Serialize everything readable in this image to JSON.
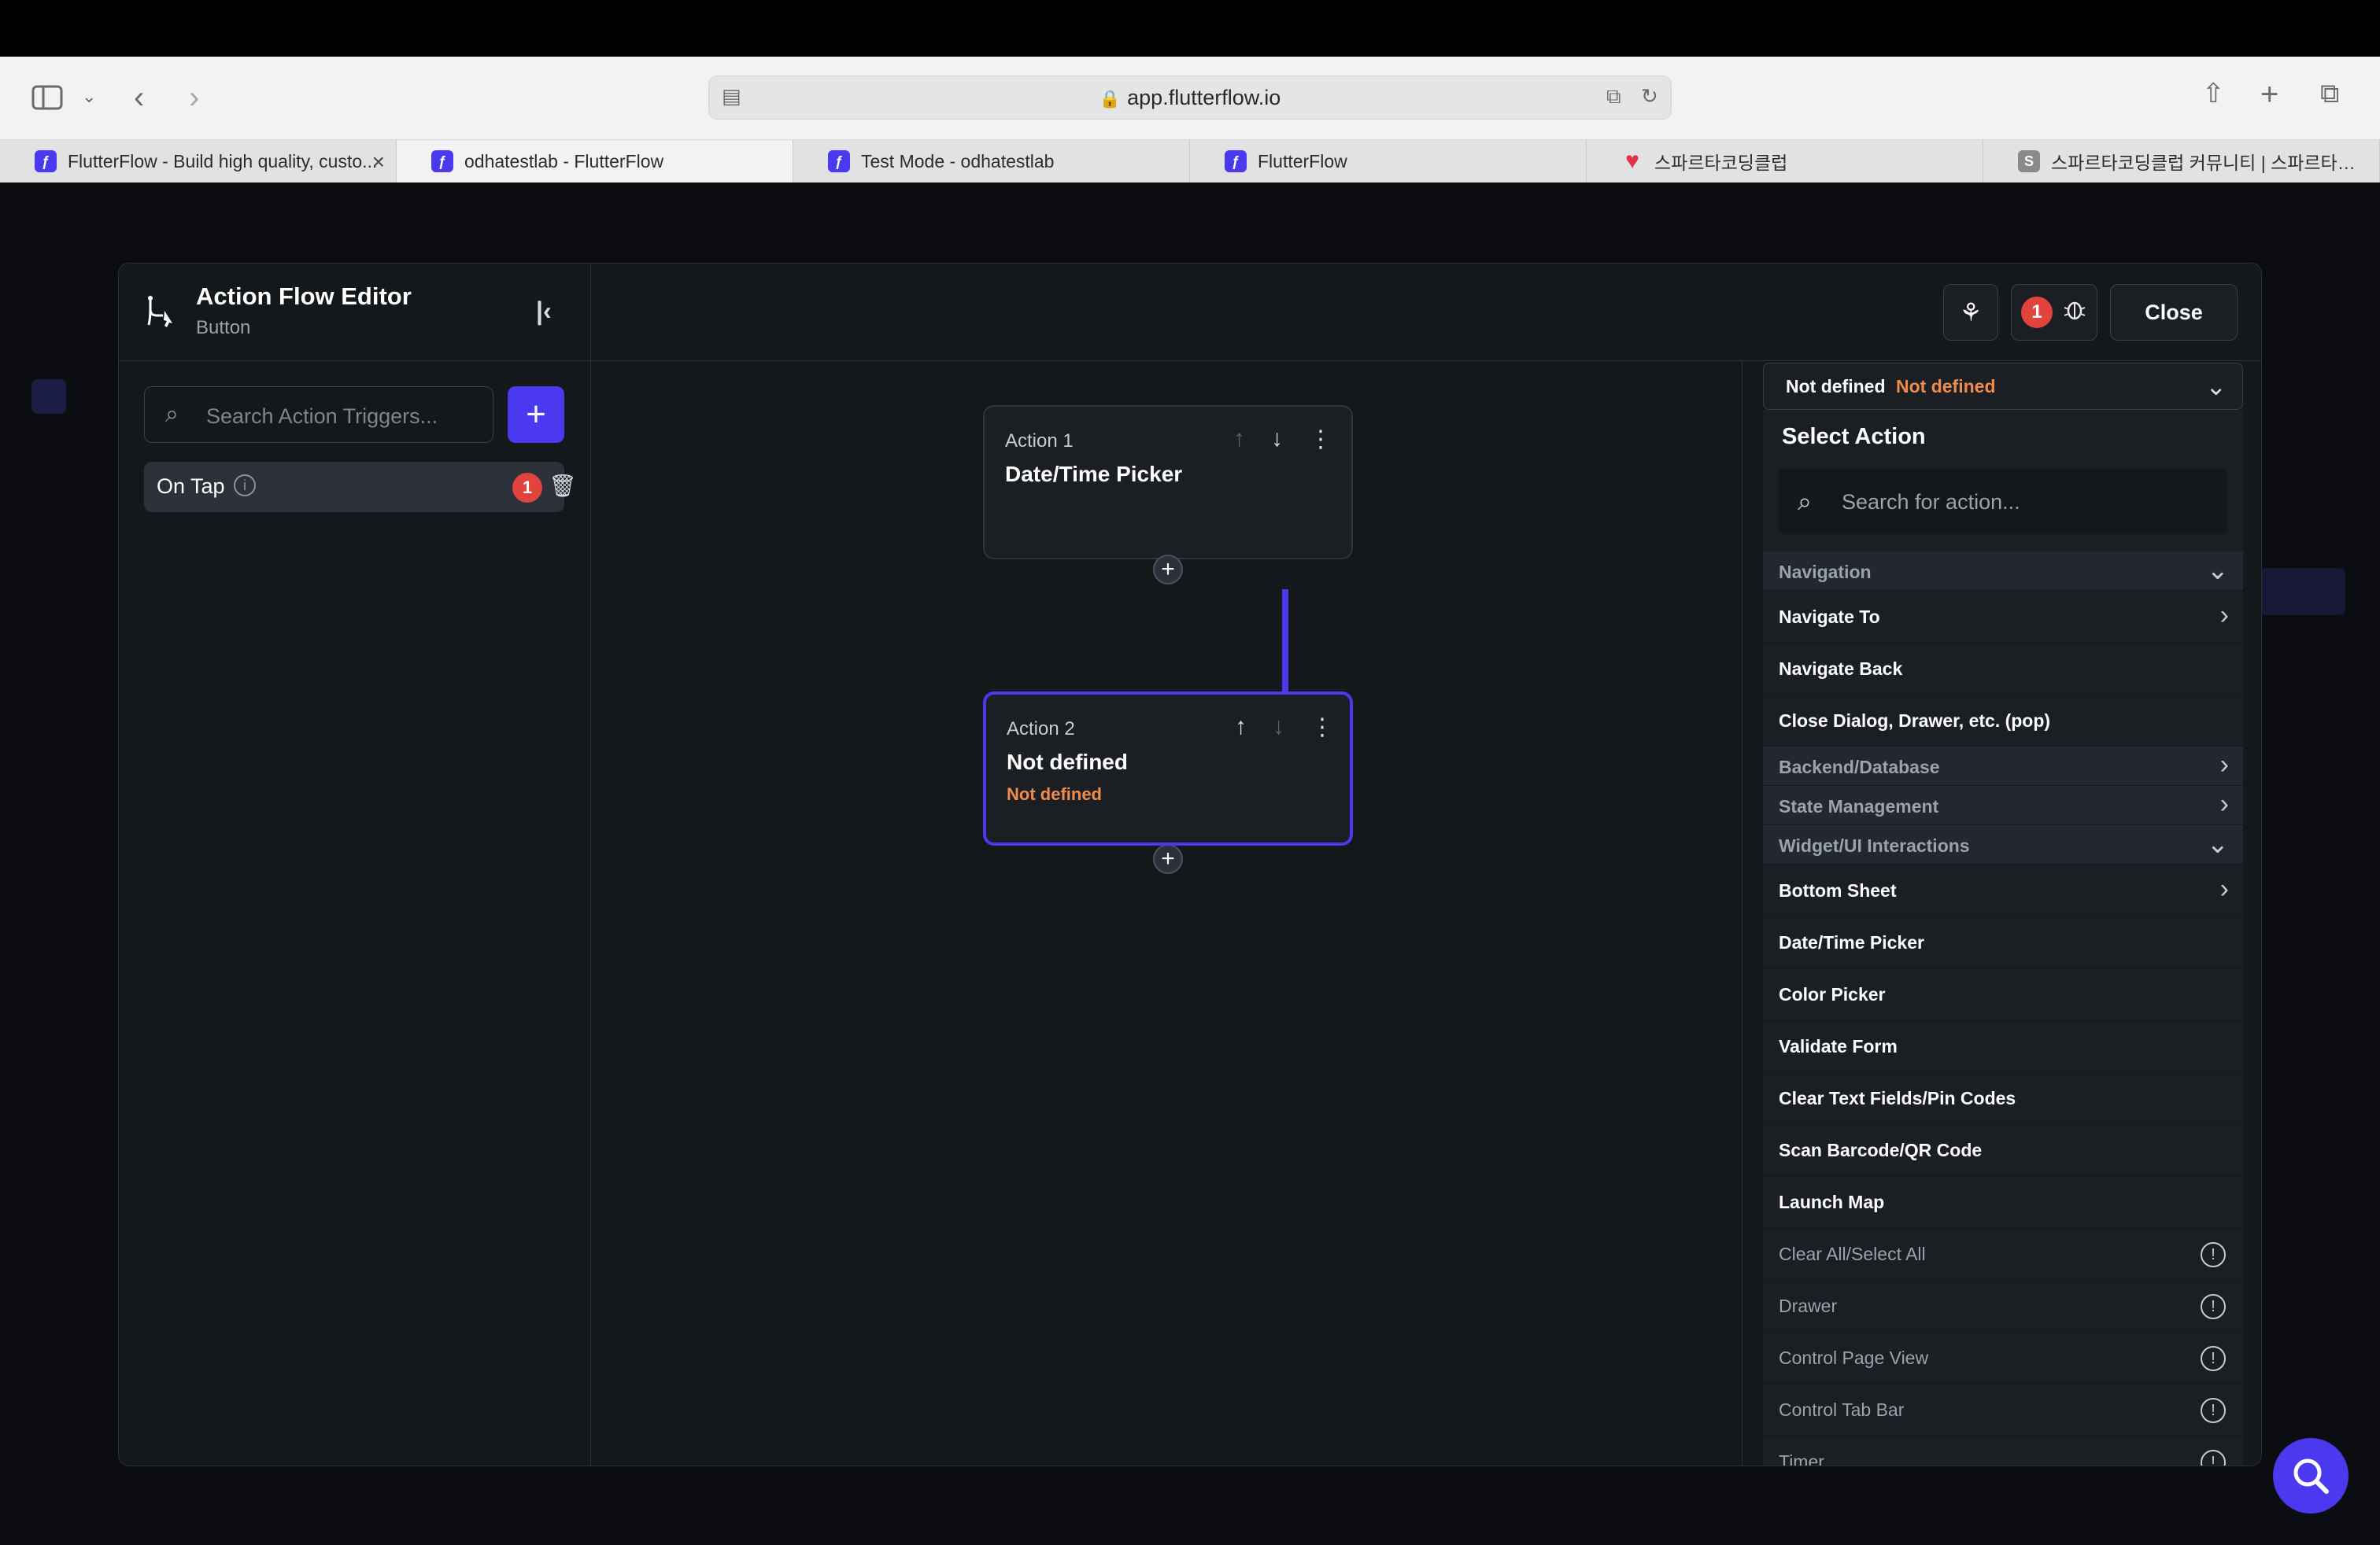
{
  "browser": {
    "url": "app.flutterflow.io",
    "tabs": [
      {
        "label": "FlutterFlow - Build high quality, custo...",
        "icon": "flutterflow-logo-icon"
      },
      {
        "label": "odhatestlab - FlutterFlow",
        "icon": "flutterflow-app-icon"
      },
      {
        "label": "Test Mode - odhatestlab",
        "icon": "flutterflow-app-icon"
      },
      {
        "label": "FlutterFlow",
        "icon": "flutterflow-app-icon"
      },
      {
        "label": "스파르타코딩클럽",
        "icon": "sparta-heart-icon"
      },
      {
        "label": "스파르타코딩클럽 커뮤니티 | 스파르타코딩클...",
        "icon": "sparta-s-icon",
        "icon_text": "S"
      }
    ]
  },
  "editor": {
    "title": "Action Flow Editor",
    "subtitle": "Button",
    "debug_count": "1",
    "close_label": "Close"
  },
  "triggers": {
    "search_placeholder": "Search Action Triggers...",
    "items": [
      {
        "label": "On Tap",
        "badge": "1"
      }
    ]
  },
  "flow": {
    "actions": [
      {
        "label": "Action 1",
        "title": "Date/Time Picker",
        "subtitle": ""
      },
      {
        "label": "Action 2",
        "title": "Not defined",
        "subtitle": "Not defined"
      }
    ]
  },
  "select_action": {
    "current_value": "Not defined",
    "current_status": "Not defined",
    "title": "Select Action",
    "search_placeholder": "Search for action...",
    "rows": [
      {
        "label": "Navigation",
        "kind": "category",
        "chevron": "down"
      },
      {
        "label": "Navigate To",
        "kind": "item",
        "chevron": "right"
      },
      {
        "label": "Navigate Back",
        "kind": "item"
      },
      {
        "label": "Close Dialog, Drawer, etc. (pop)",
        "kind": "item"
      },
      {
        "label": "Backend/Database",
        "kind": "category",
        "chevron": "right"
      },
      {
        "label": "State Management",
        "kind": "category",
        "chevron": "right"
      },
      {
        "label": "Widget/UI Interactions",
        "kind": "category",
        "chevron": "down"
      },
      {
        "label": "Bottom Sheet",
        "kind": "item",
        "chevron": "right"
      },
      {
        "label": "Date/Time Picker",
        "kind": "item"
      },
      {
        "label": "Color Picker",
        "kind": "item"
      },
      {
        "label": "Validate Form",
        "kind": "item"
      },
      {
        "label": "Clear Text Fields/Pin Codes",
        "kind": "item"
      },
      {
        "label": "Scan Barcode/QR Code",
        "kind": "item"
      },
      {
        "label": "Launch Map",
        "kind": "item"
      },
      {
        "label": "Clear All/Select All",
        "kind": "disabled"
      },
      {
        "label": "Drawer",
        "kind": "disabled"
      },
      {
        "label": "Control Page View",
        "kind": "disabled"
      },
      {
        "label": "Control Tab Bar",
        "kind": "disabled"
      },
      {
        "label": "Timer",
        "kind": "disabled"
      }
    ]
  },
  "colors": {
    "accent": "#4b39ef",
    "warning": "#f08b4c",
    "badge": "#e0443c"
  }
}
